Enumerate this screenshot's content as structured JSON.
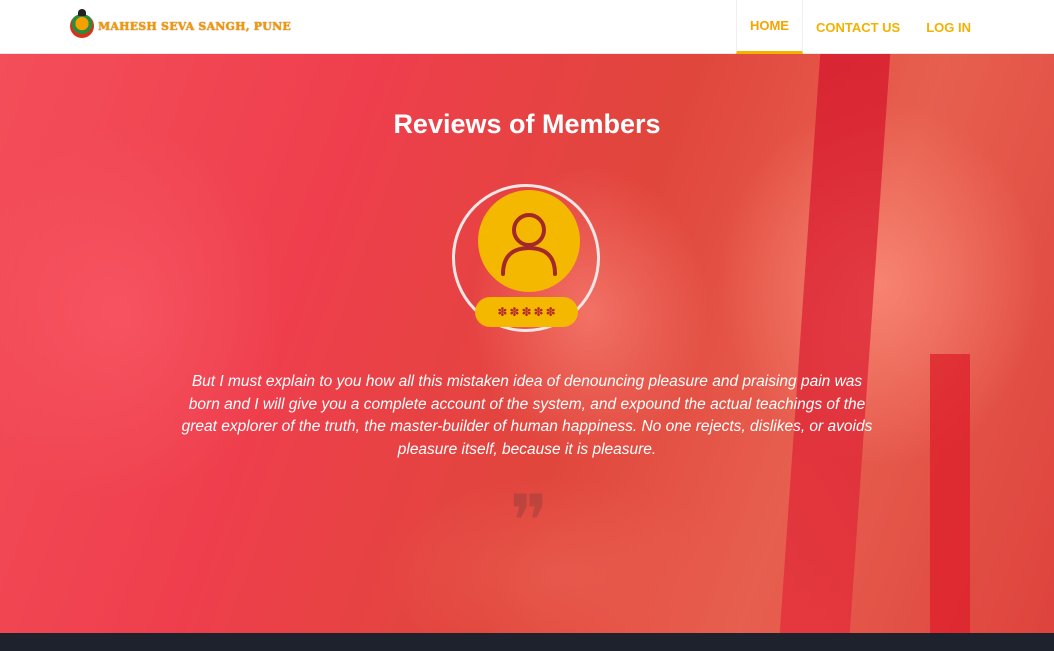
{
  "header": {
    "brand_text": "MAHESH SEVA SANGH, PUNE",
    "logo_icon": "temple-logo-icon"
  },
  "nav": [
    {
      "label": "HOME",
      "active": true
    },
    {
      "label": "CONTACT US",
      "active": false
    },
    {
      "label": "LOG IN",
      "active": false
    }
  ],
  "hero": {
    "title": "Reviews of Members",
    "rating_stars": 5,
    "quote": "But I must explain to you how all this mistaken idea of denouncing pleasure and praising pain was born and I will give you a complete account of the system, and expound the actual teachings of the great explorer of the truth, the master-builder of human happiness. No one rejects, dislikes, or avoids pleasure itself, because it is pleasure.",
    "quote_mark_icon": "quote-icon"
  },
  "colors": {
    "accent": "#f5b100",
    "hero_tint": "#ee4b56",
    "footer": "#1d222d",
    "star": "#b32c2c"
  }
}
